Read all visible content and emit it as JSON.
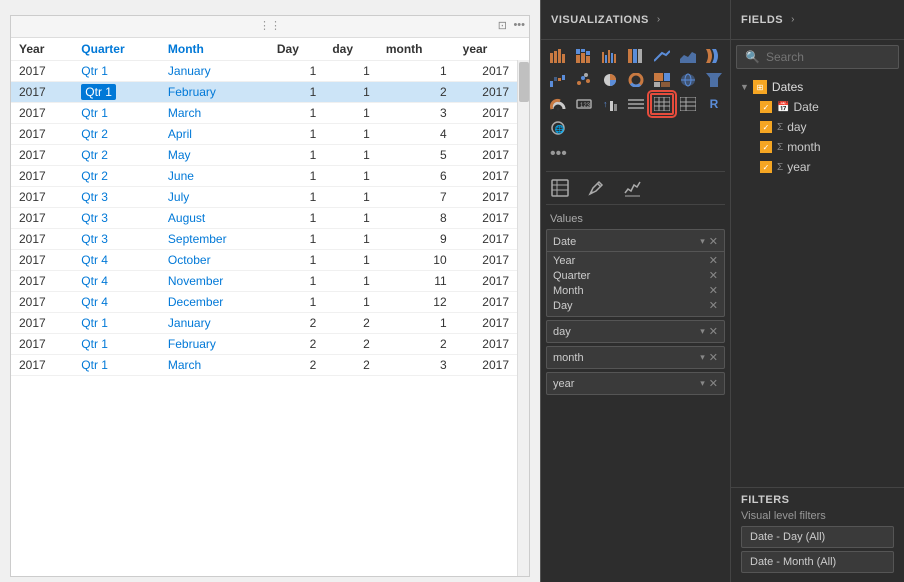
{
  "table": {
    "columns": [
      "Year",
      "Quarter",
      "Month",
      "Day",
      "day",
      "month",
      "year"
    ],
    "rows": [
      {
        "year": "2017",
        "quarter": "Qtr 1",
        "month": "January",
        "day": "1",
        "dayNum": "1",
        "monthNum": "1",
        "yearNum": "2017",
        "selected": false
      },
      {
        "year": "2017",
        "quarter": "Qtr 1",
        "month": "February",
        "day": "1",
        "dayNum": "1",
        "monthNum": "2",
        "yearNum": "2017",
        "selected": true
      },
      {
        "year": "2017",
        "quarter": "Qtr 1",
        "month": "March",
        "day": "1",
        "dayNum": "1",
        "monthNum": "3",
        "yearNum": "2017",
        "selected": false
      },
      {
        "year": "2017",
        "quarter": "Qtr 2",
        "month": "April",
        "day": "1",
        "dayNum": "1",
        "monthNum": "4",
        "yearNum": "2017",
        "selected": false
      },
      {
        "year": "2017",
        "quarter": "Qtr 2",
        "month": "May",
        "day": "1",
        "dayNum": "1",
        "monthNum": "5",
        "yearNum": "2017",
        "selected": false
      },
      {
        "year": "2017",
        "quarter": "Qtr 2",
        "month": "June",
        "day": "1",
        "dayNum": "1",
        "monthNum": "6",
        "yearNum": "2017",
        "selected": false
      },
      {
        "year": "2017",
        "quarter": "Qtr 3",
        "month": "July",
        "day": "1",
        "dayNum": "1",
        "monthNum": "7",
        "yearNum": "2017",
        "selected": false
      },
      {
        "year": "2017",
        "quarter": "Qtr 3",
        "month": "August",
        "day": "1",
        "dayNum": "1",
        "monthNum": "8",
        "yearNum": "2017",
        "selected": false
      },
      {
        "year": "2017",
        "quarter": "Qtr 3",
        "month": "September",
        "day": "1",
        "dayNum": "1",
        "monthNum": "9",
        "yearNum": "2017",
        "selected": false
      },
      {
        "year": "2017",
        "quarter": "Qtr 4",
        "month": "October",
        "day": "1",
        "dayNum": "1",
        "monthNum": "10",
        "yearNum": "2017",
        "selected": false
      },
      {
        "year": "2017",
        "quarter": "Qtr 4",
        "month": "November",
        "day": "1",
        "dayNum": "1",
        "monthNum": "11",
        "yearNum": "2017",
        "selected": false
      },
      {
        "year": "2017",
        "quarter": "Qtr 4",
        "month": "December",
        "day": "1",
        "dayNum": "1",
        "monthNum": "12",
        "yearNum": "2017",
        "selected": false
      },
      {
        "year": "2017",
        "quarter": "Qtr 1",
        "month": "January",
        "day": "2",
        "dayNum": "2",
        "monthNum": "1",
        "yearNum": "2017",
        "selected": false
      },
      {
        "year": "2017",
        "quarter": "Qtr 1",
        "month": "February",
        "day": "2",
        "dayNum": "2",
        "monthNum": "2",
        "yearNum": "2017",
        "selected": false
      },
      {
        "year": "2017",
        "quarter": "Qtr 1",
        "month": "March",
        "day": "2",
        "dayNum": "2",
        "monthNum": "3",
        "yearNum": "2017",
        "selected": false
      }
    ]
  },
  "visualizations": {
    "title": "VISUALIZATIONS",
    "chevron": "›",
    "icons": [
      {
        "name": "bar-chart",
        "symbol": "▬"
      },
      {
        "name": "stacked-bar",
        "symbol": "▤"
      },
      {
        "name": "clustered-bar",
        "symbol": "▦"
      },
      {
        "name": "bar-100",
        "symbol": "▥"
      },
      {
        "name": "line-chart",
        "symbol": "📈"
      },
      {
        "name": "area-chart",
        "symbol": "📊"
      },
      {
        "name": "ribbon-chart",
        "symbol": "🎀"
      },
      {
        "name": "waterfall",
        "symbol": "⬛"
      },
      {
        "name": "scatter",
        "symbol": "⬟"
      },
      {
        "name": "pie-chart",
        "symbol": "◉"
      },
      {
        "name": "donut",
        "symbol": "⊙"
      },
      {
        "name": "treemap",
        "symbol": "⊞"
      },
      {
        "name": "map",
        "symbol": "🗺"
      },
      {
        "name": "funnel",
        "symbol": "⊽"
      },
      {
        "name": "gauge",
        "symbol": "◔"
      },
      {
        "name": "card",
        "symbol": "▭"
      },
      {
        "name": "kpi",
        "symbol": "⬆"
      },
      {
        "name": "slicer",
        "symbol": "☰"
      },
      {
        "name": "table",
        "symbol": "⊟",
        "highlighted": true
      },
      {
        "name": "matrix",
        "symbol": "⊞"
      },
      {
        "name": "r-visual",
        "symbol": "R"
      },
      {
        "name": "python",
        "symbol": "🐍"
      }
    ],
    "tabs": [
      {
        "name": "fields-tab",
        "symbol": "⊞",
        "active": false
      },
      {
        "name": "format-tab",
        "symbol": "🖌",
        "active": false
      },
      {
        "name": "analytics-tab",
        "symbol": "📊",
        "active": false
      }
    ],
    "values_label": "Values",
    "values_fields": [
      {
        "name": "Date",
        "hasChevron": true
      },
      {
        "name": "Year",
        "hasChevron": false
      },
      {
        "name": "Quarter",
        "hasChevron": false
      },
      {
        "name": "Month",
        "hasChevron": false
      },
      {
        "name": "Day",
        "hasChevron": false
      }
    ],
    "pills": [
      {
        "label": "day",
        "name": "day-pill"
      },
      {
        "label": "month",
        "name": "month-pill"
      },
      {
        "label": "year",
        "name": "year-pill"
      }
    ]
  },
  "fields": {
    "title": "FIELDS",
    "chevron": "›",
    "search_placeholder": "Search",
    "tree": [
      {
        "name": "Dates",
        "items": [
          {
            "label": "Date",
            "icon": "calendar"
          },
          {
            "label": "day",
            "icon": "sigma"
          },
          {
            "label": "month",
            "icon": "sigma"
          },
          {
            "label": "year",
            "icon": "sigma"
          }
        ]
      }
    ]
  },
  "filters": {
    "title": "FILTERS",
    "visual_level_label": "Visual level filters",
    "items": [
      {
        "label": "Date - Day (All)"
      },
      {
        "label": "Date - Month (All)"
      }
    ]
  }
}
